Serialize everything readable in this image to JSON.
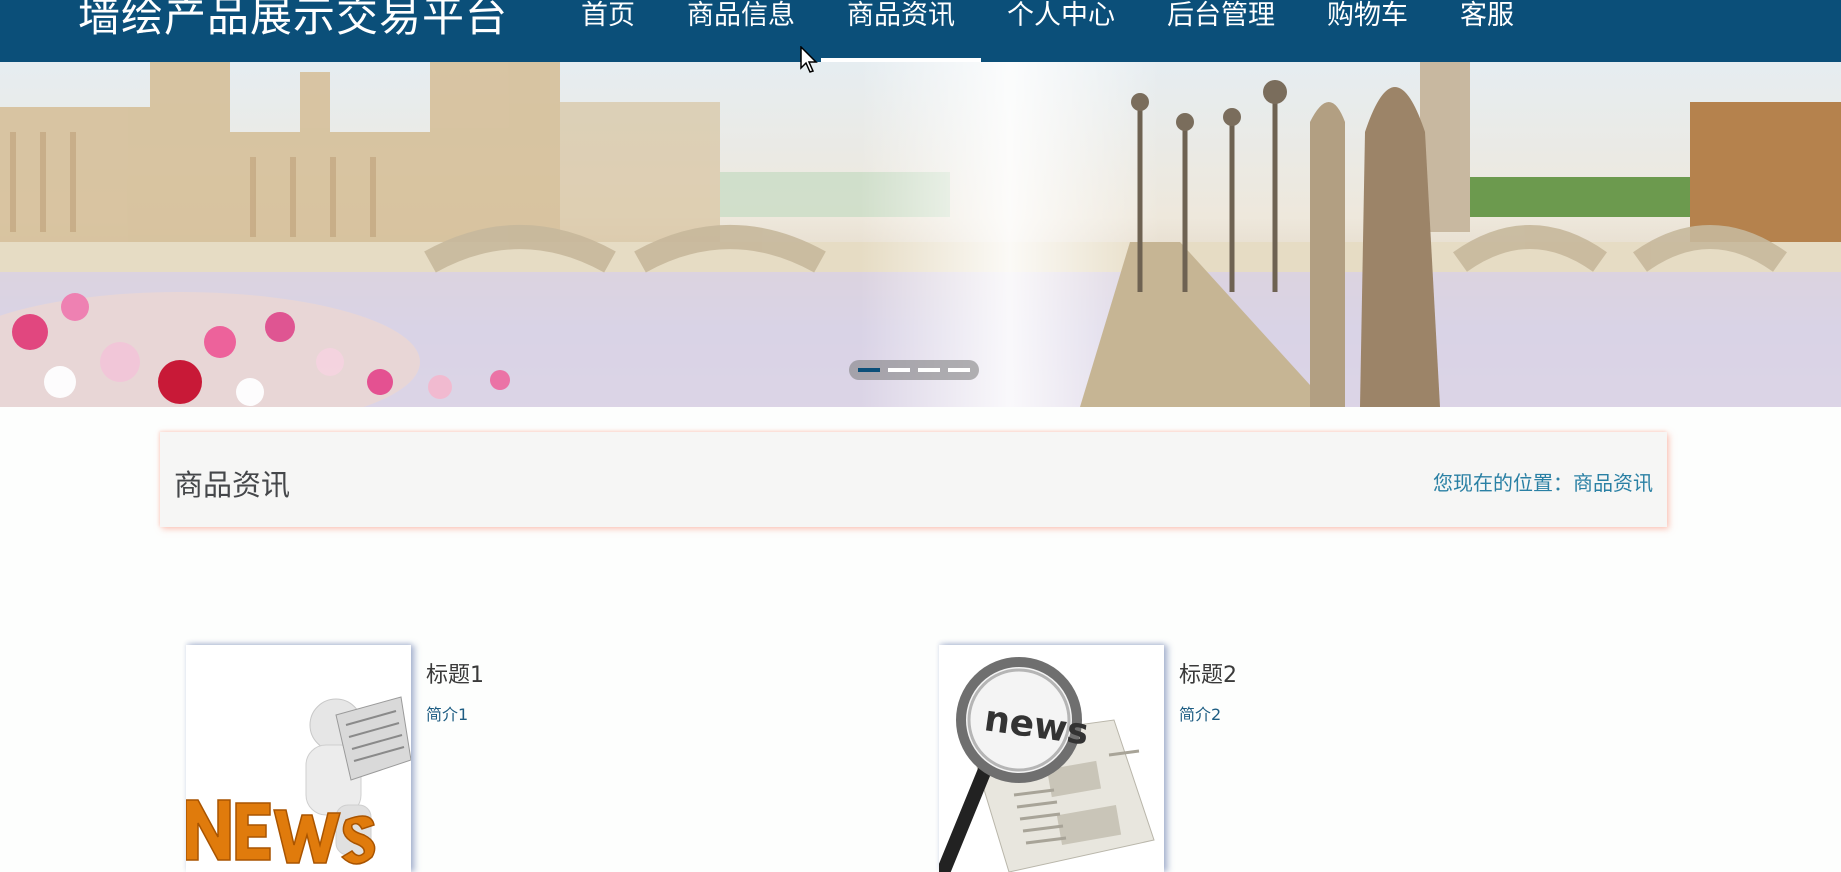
{
  "header": {
    "site_title": "墙绘产品展示交易平台",
    "nav": [
      {
        "label": "首页"
      },
      {
        "label": "商品信息"
      },
      {
        "label": "商品资讯",
        "active": true
      },
      {
        "label": "个人中心"
      },
      {
        "label": "后台管理"
      },
      {
        "label": "购物车"
      },
      {
        "label": "客服"
      }
    ]
  },
  "banner": {
    "slide_count": 4,
    "active_slide": 1
  },
  "page": {
    "title": "商品资讯",
    "breadcrumb": "您现在的位置：商品资讯"
  },
  "news": [
    {
      "title": "标题1",
      "summary": "简介1",
      "image_icon": "news-reader-icon"
    },
    {
      "title": "标题2",
      "summary": "简介2",
      "image_icon": "magnifier-newspaper-icon"
    }
  ],
  "colors": {
    "header_bg": "#0b4f79",
    "accent_link": "#2a80a4",
    "active_dot": "#0b4f79"
  }
}
